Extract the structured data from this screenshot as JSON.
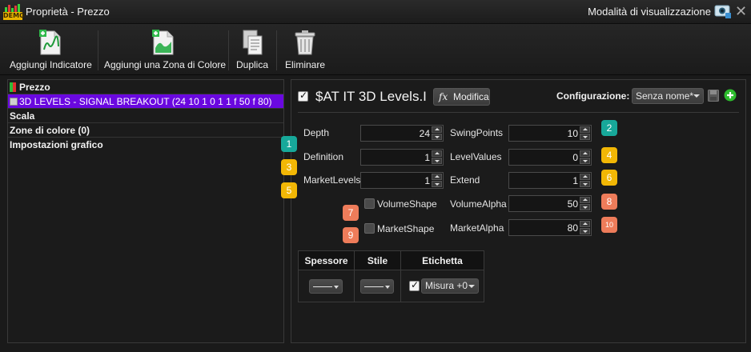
{
  "window": {
    "title": "Proprietà - Prezzo",
    "view_mode_label": "Modalità di visualizzazione",
    "logo_text": "DEMO"
  },
  "toolbar": {
    "add_indicator": "Aggiungi Indicatore",
    "add_color_zone": "Aggiungi una Zona di Colore",
    "duplicate": "Duplica",
    "delete": "Eliminare"
  },
  "tree": {
    "price": "Prezzo",
    "indicator": "3D LEVELS - SIGNAL BREAKOUT (24 10 1 0 1 1 f 50 f 80)",
    "scale": "Scala",
    "color_zones": "Zone di colore (0)",
    "chart_settings": "Impostazioni grafico"
  },
  "indicator": {
    "name": "$AT IT 3D Levels.I",
    "enabled": true,
    "modify_label": "Modifica",
    "modify_icon_text": "fx",
    "config_label": "Configurazione:",
    "config_value": "Senza nome*"
  },
  "params": {
    "depth": {
      "label": "Depth",
      "value": "24"
    },
    "swing_points": {
      "label": "SwingPoints",
      "value": "10"
    },
    "definition": {
      "label": "Definition",
      "value": "1"
    },
    "level_values": {
      "label": "LevelValues",
      "value": "0"
    },
    "market_levels": {
      "label": "MarketLevels",
      "value": "1"
    },
    "extend": {
      "label": "Extend",
      "value": "1"
    },
    "volume_shape": {
      "label": "VolumeShape",
      "checked": false
    },
    "volume_alpha": {
      "label": "VolumeAlpha",
      "value": "50"
    },
    "market_shape": {
      "label": "MarketShape",
      "checked": false
    },
    "market_alpha": {
      "label": "MarketAlpha",
      "value": "80"
    }
  },
  "badges": {
    "b1": "1",
    "b2": "2",
    "b3": "3",
    "b4": "4",
    "b5": "5",
    "b6": "6",
    "b7": "7",
    "b8": "8",
    "b9": "9",
    "b10": "10"
  },
  "style_table": {
    "headers": [
      "Spessore",
      "Stile",
      "Etichetta"
    ],
    "label_value": "Misura +0",
    "label_checked": true
  },
  "colors": {
    "selection": "#6a08e0",
    "badge_teal": "#17a89a",
    "badge_yellow": "#f2b705",
    "badge_orange": "#ee7c5a",
    "add_green": "#2dbb2d"
  }
}
